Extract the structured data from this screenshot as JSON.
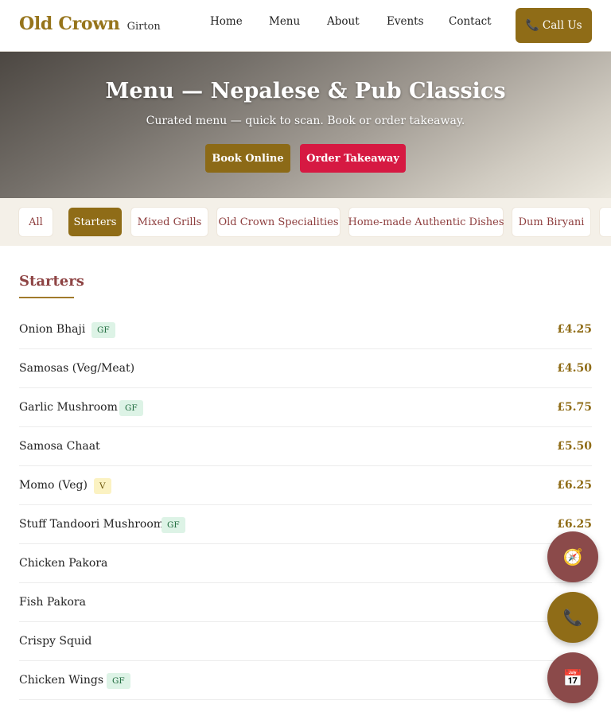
{
  "header": {
    "brand_name": "Old Crown",
    "brand_sub": "Girton",
    "nav": [
      "Home",
      "Menu",
      "About",
      "Events",
      "Contact"
    ],
    "call_label": "Call Us",
    "call_icon": "phone-icon"
  },
  "hero": {
    "title": "Menu — Nepalese & Pub Classics",
    "subtitle": "Curated menu — quick to scan. Book or order takeaway.",
    "book_label": "Book Online",
    "order_label": "Order Takeaway"
  },
  "categories": [
    {
      "label": "All",
      "active": false
    },
    {
      "label": "Starters",
      "active": true
    },
    {
      "label": "Mixed Grills",
      "active": false
    },
    {
      "label": "Old Crown Specialities",
      "active": false
    },
    {
      "label": "Home-made Authentic Dishes",
      "active": false
    },
    {
      "label": "Dum Biryani",
      "active": false
    }
  ],
  "section": {
    "title": "Starters",
    "items": [
      {
        "name": "Onion Bhaji",
        "tag": "GF",
        "price": "£4.25"
      },
      {
        "name": "Samosas (Veg/Meat)",
        "tag": "",
        "price": "£4.50"
      },
      {
        "name": "Garlic Mushroom",
        "tag": "GF",
        "price": "£5.75"
      },
      {
        "name": "Samosa Chaat",
        "tag": "",
        "price": "£5.50"
      },
      {
        "name": "Momo (Veg)",
        "tag": "V",
        "price": "£6.25"
      },
      {
        "name": "Stuff Tandoori Mushroom",
        "tag": "GF",
        "price": "£6.25"
      },
      {
        "name": "Chicken Pakora",
        "tag": "",
        "price": ""
      },
      {
        "name": "Fish Pakora",
        "tag": "",
        "price": ""
      },
      {
        "name": "Crispy Squid",
        "tag": "",
        "price": ""
      },
      {
        "name": "Chicken Wings",
        "tag": "GF",
        "price": ""
      }
    ]
  },
  "floating_buttons": [
    {
      "icon": "compass-icon",
      "glyph": "🧭"
    },
    {
      "icon": "phone-icon",
      "glyph": "📞"
    },
    {
      "icon": "calendar-icon",
      "glyph": "📅"
    }
  ],
  "colors": {
    "brand_gold": "#8f6c17",
    "accent_red": "#d61942",
    "maroon": "#8b4a4a",
    "gf_tag_bg": "#ddf3e6",
    "v_tag_bg": "#fbf2c2"
  }
}
